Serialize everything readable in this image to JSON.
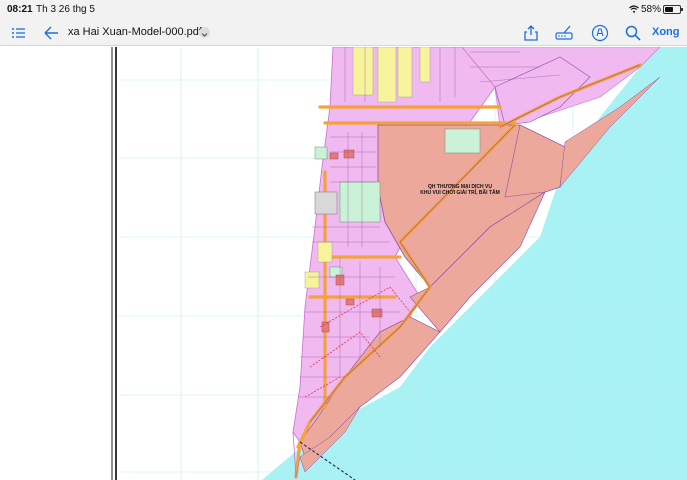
{
  "status_bar": {
    "time": "08:21",
    "date": "Th 3 26 thg 5",
    "battery": "58%",
    "battery_level": 0.58
  },
  "toolbar": {
    "document_title": "xa Hai Xuan-Model-000.pdf",
    "done_label": "Xong",
    "accent_color": "#1a6fe0",
    "icons": [
      "list-icon",
      "back-icon",
      "share-icon",
      "markup-icon",
      "annotate-icon",
      "search-icon",
      "chevron-down-icon"
    ]
  },
  "map": {
    "zone_label_line1": "QH THƯƠNG MẠI DỊCH VỤ",
    "zone_label_line2": "KHU VUI CHƠI GIẢI TRÍ, BÃI TẮM",
    "colors": {
      "sea": "#a9f2f4",
      "residential": "#f0b9f0",
      "commercial": "#eca89a",
      "road": "#f6a23a",
      "agriculture": "#f7f39a",
      "green": "#c9f2d6"
    }
  }
}
